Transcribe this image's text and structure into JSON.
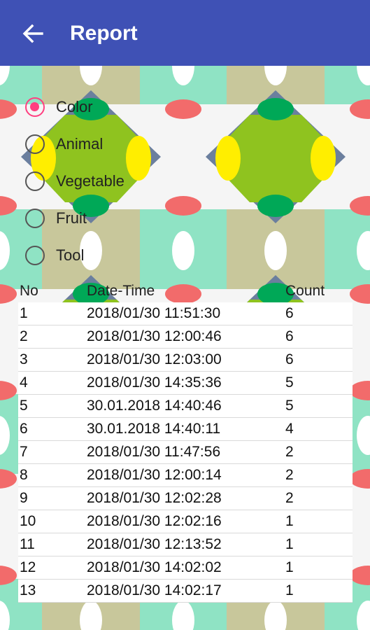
{
  "appbar": {
    "title": "Report",
    "back_icon": "arrow-back-icon",
    "color": "#3f51b5"
  },
  "categories": [
    {
      "label": "Color",
      "checked": true
    },
    {
      "label": "Animal",
      "checked": false
    },
    {
      "label": "Vegetable",
      "checked": false
    },
    {
      "label": "Fruit",
      "checked": false
    },
    {
      "label": "Tool",
      "checked": false
    }
  ],
  "table": {
    "headers": {
      "no": "No",
      "datetime": "Date-Time",
      "count": "Count"
    },
    "rows": [
      {
        "no": "1",
        "datetime": "2018/01/30 11:51:30",
        "count": "6"
      },
      {
        "no": "2",
        "datetime": "2018/01/30 12:00:46",
        "count": "6"
      },
      {
        "no": "3",
        "datetime": "2018/01/30 12:03:00",
        "count": "6"
      },
      {
        "no": "4",
        "datetime": "2018/01/30 14:35:36",
        "count": "5"
      },
      {
        "no": "5",
        "datetime": "30.01.2018 14:40:46",
        "count": "5"
      },
      {
        "no": "6",
        "datetime": "30.01.2018 14:40:11",
        "count": "4"
      },
      {
        "no": "7",
        "datetime": "2018/01/30 11:47:56",
        "count": "2"
      },
      {
        "no": "8",
        "datetime": "2018/01/30 12:00:14",
        "count": "2"
      },
      {
        "no": "9",
        "datetime": "2018/01/30 12:02:28",
        "count": "2"
      },
      {
        "no": "10",
        "datetime": "2018/01/30 12:02:16",
        "count": "1"
      },
      {
        "no": "11",
        "datetime": "2018/01/30 12:13:52",
        "count": "1"
      },
      {
        "no": "12",
        "datetime": "2018/01/30 14:02:02",
        "count": "1"
      },
      {
        "no": "13",
        "datetime": "2018/01/30 14:02:17",
        "count": "1"
      }
    ]
  },
  "colors": {
    "accent": "#ff3f80",
    "background_mint": "#8fe3c4",
    "pattern_olive": "#c8c79b",
    "pattern_slate": "#6b7f9e",
    "pattern_lime": "#8fc31f",
    "pattern_green": "#00a857",
    "pattern_yellow": "#ffee00",
    "pattern_coral": "#f26b6b"
  }
}
